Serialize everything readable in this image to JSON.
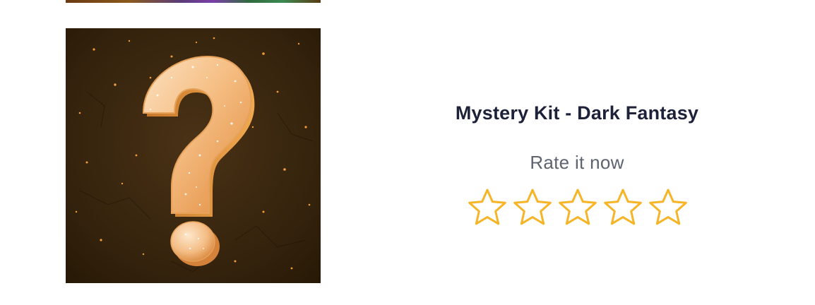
{
  "product": {
    "title": "Mystery Kit - Dark Fantasy",
    "image_icon": "question-mark-icon"
  },
  "rating": {
    "label": "Rate it now",
    "max_stars": 5,
    "current_value": 0,
    "star_icon": "star-outline-icon",
    "star_color": "#f6b427"
  },
  "colors": {
    "image_background": "#3a260f",
    "question_mark": "#f3b77a",
    "title_text": "#1d2239",
    "label_text": "#5d6470"
  }
}
